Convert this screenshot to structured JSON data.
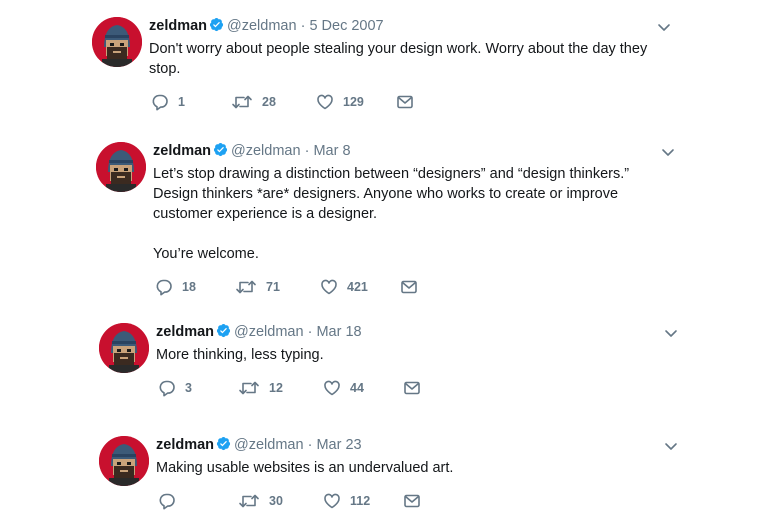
{
  "tweets": [
    {
      "name": "zeldman",
      "handle": "@zeldman",
      "separator": "·",
      "time": "5 Dec 2007",
      "paragraphs": [
        "Don't worry about people stealing your design work. Worry about the day they stop."
      ],
      "replies": "1",
      "retweets": "28",
      "likes": "129"
    },
    {
      "name": "zeldman",
      "handle": "@zeldman",
      "separator": "·",
      "time": "Mar 8",
      "paragraphs": [
        "Let’s stop drawing a distinction between “designers” and “design thinkers.” Design thinkers *are* designers. Anyone who works to create or improve customer experience is a designer.",
        "You’re welcome."
      ],
      "replies": "18",
      "retweets": "71",
      "likes": "421"
    },
    {
      "name": "zeldman",
      "handle": "@zeldman",
      "separator": "·",
      "time": "Mar 18",
      "paragraphs": [
        "More thinking, less typing."
      ],
      "replies": "3",
      "retweets": "12",
      "likes": "44"
    },
    {
      "name": "zeldman",
      "handle": "@zeldman",
      "separator": "·",
      "time": "Mar 23",
      "paragraphs": [
        "Making usable websites is an undervalued art."
      ],
      "replies": "",
      "retweets": "30",
      "likes": "112"
    }
  ],
  "icons": {
    "verified": "verified-badge-icon",
    "caret": "chevron-down-icon",
    "reply": "reply-icon",
    "retweet": "retweet-icon",
    "like": "heart-icon",
    "dm": "envelope-icon"
  },
  "colors": {
    "text": "#14171a",
    "muted": "#657786",
    "verified": "#1da1f2",
    "avatar_bg": "#c8102e"
  }
}
